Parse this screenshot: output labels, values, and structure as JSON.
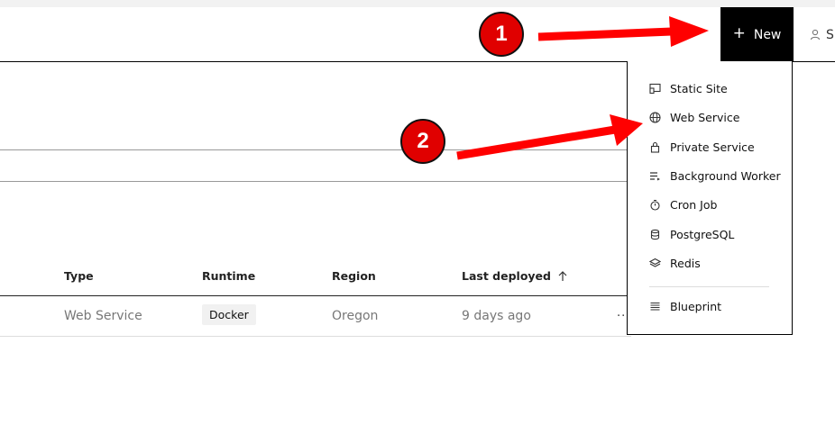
{
  "header": {
    "new_label": "New",
    "user_label": "S"
  },
  "table": {
    "headers": [
      "Type",
      "Runtime",
      "Region",
      "Last deployed"
    ],
    "sort_icon": "arrow-up-icon",
    "row": {
      "type": "Web Service",
      "runtime": "Docker",
      "region": "Oregon",
      "last_deployed": "9 days ago",
      "more": "..."
    }
  },
  "menu": {
    "items": [
      {
        "label": "Static Site",
        "icon": "static-site-icon"
      },
      {
        "label": "Web Service",
        "icon": "globe-icon"
      },
      {
        "label": "Private Service",
        "icon": "lock-icon"
      },
      {
        "label": "Background Worker",
        "icon": "worker-icon"
      },
      {
        "label": "Cron Job",
        "icon": "timer-icon"
      },
      {
        "label": "PostgreSQL",
        "icon": "database-icon"
      },
      {
        "label": "Redis",
        "icon": "layers-icon"
      }
    ],
    "blueprint": {
      "label": "Blueprint",
      "icon": "blueprint-icon"
    }
  },
  "annotations": {
    "callout_1": "1",
    "callout_2": "2",
    "arrow_color": "#ff0000",
    "callout_color": "#e00000"
  }
}
